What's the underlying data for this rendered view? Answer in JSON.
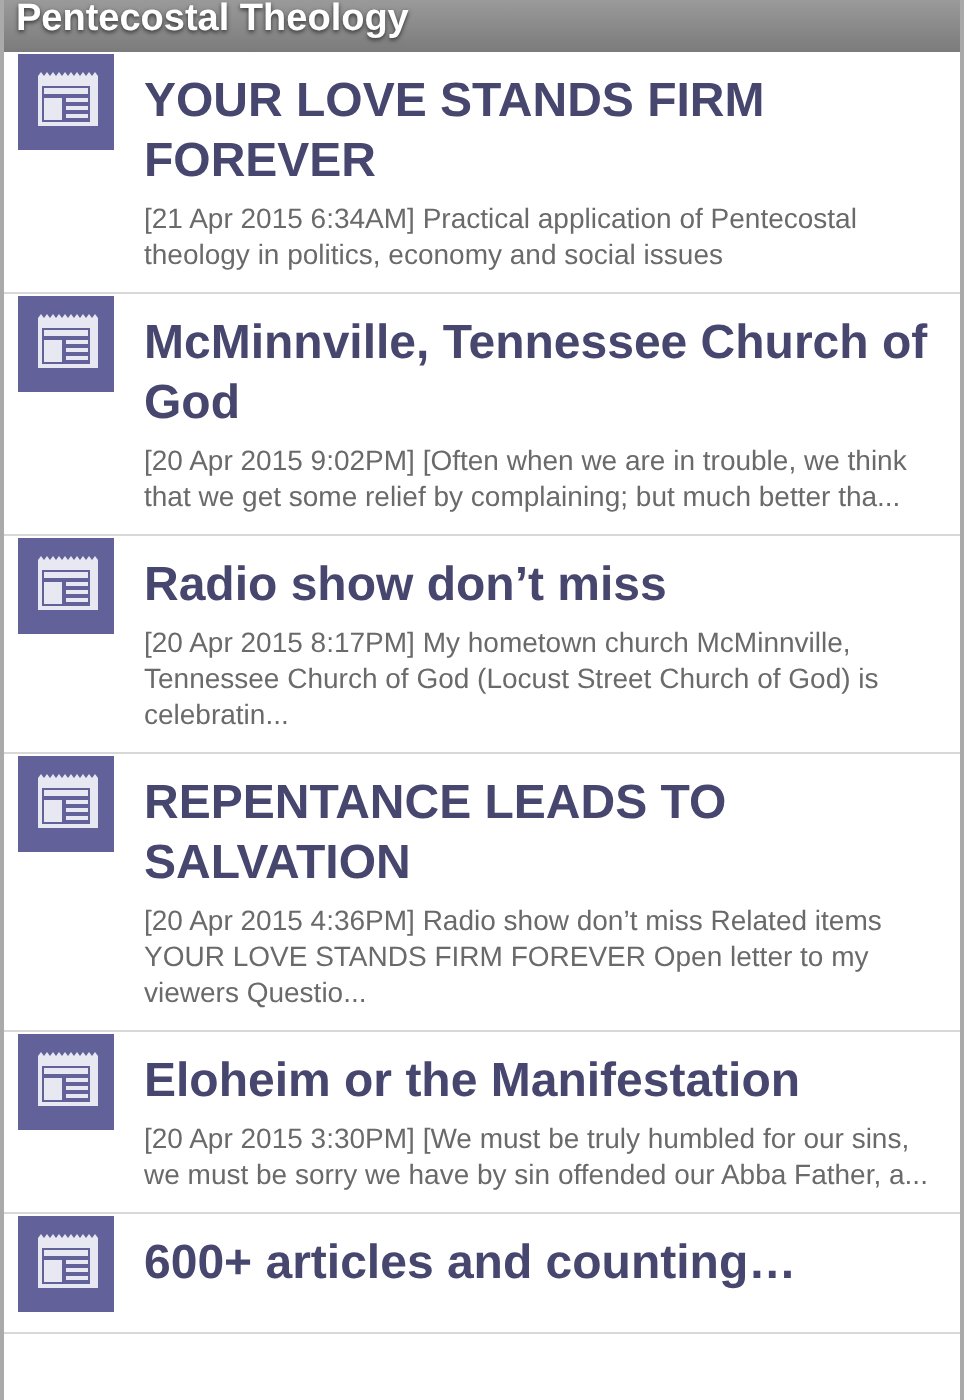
{
  "header": {
    "title": "Pentecostal Theology"
  },
  "articles": [
    {
      "title": "YOUR LOVE STANDS FIRM FOREVER",
      "summary": "[21 Apr 2015 6:34AM] Practical application of Pentecostal theology in politics, economy and social issues"
    },
    {
      "title": "McMinnville, Tennessee Church of God",
      "summary": "[20 Apr 2015 9:02PM] [Often when we are in trouble, we think that we get some relief by complaining; but much better tha..."
    },
    {
      "title": "Radio show don’t miss",
      "summary": "[20 Apr 2015 8:17PM] My hometown church McMinnville, Tennessee Church of God (Locust Street Church of God) is celebratin..."
    },
    {
      "title": "REPENTANCE LEADS TO SALVATION",
      "summary": "[20 Apr 2015 4:36PM] Radio show don’t miss Related items YOUR LOVE STANDS FIRM FOREVER Open letter to my viewers Questio..."
    },
    {
      "title": "Eloheim or the Manifestation",
      "summary": "[20 Apr 2015 3:30PM] [We must be truly humbled for our sins, we must be sorry we have by sin offended our Abba Father, a..."
    },
    {
      "title": "600+ articles and counting…"
    }
  ]
}
